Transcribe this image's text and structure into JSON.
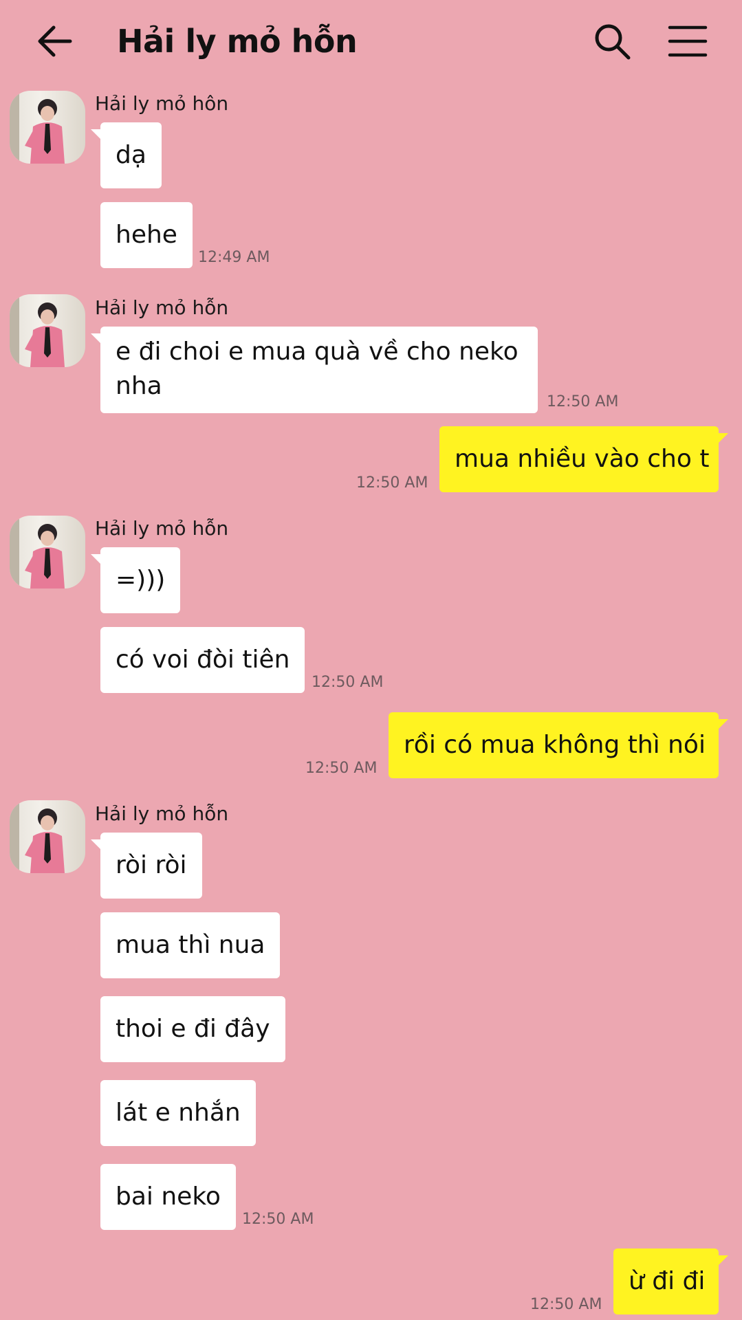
{
  "header": {
    "title": "Hải ly mỏ hỗn",
    "back_icon": "arrow-left-icon",
    "search_icon": "search-icon",
    "menu_icon": "hamburger-menu-icon"
  },
  "colors": {
    "background": "#eca7b1",
    "incoming_bubble": "#ffffff",
    "outgoing_bubble": "#fff321"
  },
  "messages": {
    "g1": {
      "sender": "Hải ly mỏ hôn",
      "m1": "dạ",
      "m2": "hehe",
      "time": "12:49 AM"
    },
    "g2": {
      "sender": "Hải ly mỏ hỗn",
      "m1": "e đi choi e mua quà về cho neko nha",
      "time": "12:50 AM"
    },
    "o1": {
      "text": "mua nhiều vào cho t",
      "time": "12:50 AM"
    },
    "g3": {
      "sender": "Hải ly mỏ hỗn",
      "m1": "=)))",
      "m2": "có voi đòi tiên",
      "time": "12:50 AM"
    },
    "o2": {
      "text": "rồi có mua không thì nói",
      "time": "12:50 AM"
    },
    "g4": {
      "sender": "Hải ly mỏ hỗn",
      "m1": "ròi ròi",
      "m2": "mua thì nua",
      "m3": "thoi e đi đây",
      "m4": "lát e nhắn",
      "m5": "bai neko",
      "time": "12:50 AM"
    },
    "o3": {
      "text": "ừ đi đi",
      "time": "12:50 AM"
    }
  }
}
